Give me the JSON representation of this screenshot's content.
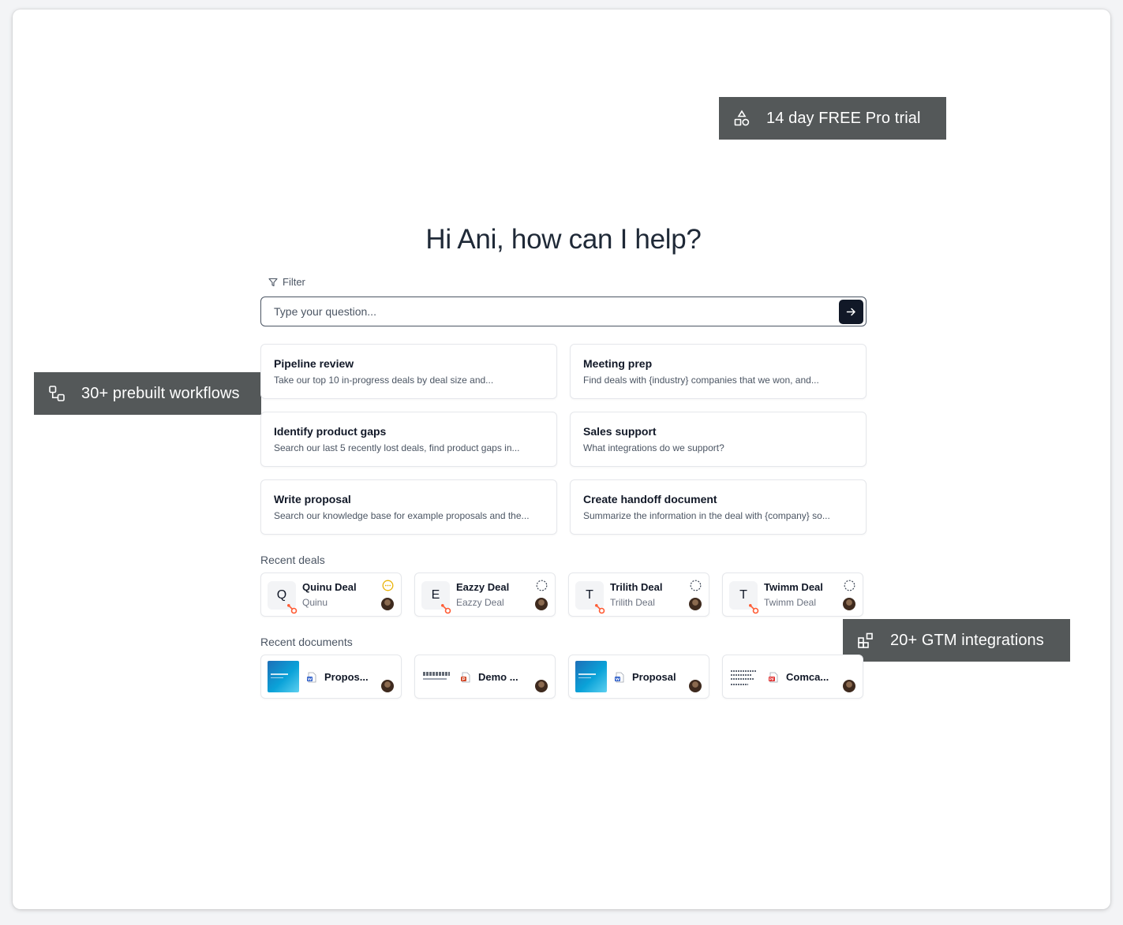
{
  "callouts": {
    "trial": "14 day FREE Pro trial",
    "workflows": "30+ prebuilt workflows",
    "integrations": "20+ GTM integrations"
  },
  "greeting": "Hi Ani, how can I help?",
  "filter_label": "Filter",
  "search": {
    "placeholder": "Type your question..."
  },
  "workflows": [
    {
      "title": "Pipeline review",
      "desc": "Take our top 10 in-progress deals by deal size and..."
    },
    {
      "title": "Meeting prep",
      "desc": "Find deals with {industry} companies that we won, and..."
    },
    {
      "title": "Identify product gaps",
      "desc": "Search our last 5 recently lost deals, find product gaps in..."
    },
    {
      "title": "Sales support",
      "desc": "What integrations do we support?"
    },
    {
      "title": "Write proposal",
      "desc": "Search our knowledge base for example proposals and the..."
    },
    {
      "title": "Create handoff document",
      "desc": "Summarize the information in the deal with {company} so..."
    }
  ],
  "recent_deals_label": "Recent deals",
  "deals": [
    {
      "letter": "Q",
      "name": "Quinu Deal",
      "sub": "Quinu",
      "status": "in-progress"
    },
    {
      "letter": "E",
      "name": "Eazzy Deal",
      "sub": "Eazzy Deal",
      "status": "open"
    },
    {
      "letter": "T",
      "name": "Trilith Deal",
      "sub": "Trilith Deal",
      "status": "open"
    },
    {
      "letter": "T",
      "name": "Twimm Deal",
      "sub": "Twimm Deal",
      "status": "open"
    }
  ],
  "recent_documents_label": "Recent documents",
  "documents": [
    {
      "name": "Propos...",
      "file_type": "word"
    },
    {
      "name": "Demo ...",
      "file_type": "powerpoint"
    },
    {
      "name": "Proposal",
      "file_type": "word"
    },
    {
      "name": "Comca...",
      "file_type": "pdf"
    }
  ],
  "colors": {
    "callout_bg": "#545859",
    "send_button": "#111827",
    "hubspot": "#ff5c35",
    "in_progress": "#eab308"
  }
}
